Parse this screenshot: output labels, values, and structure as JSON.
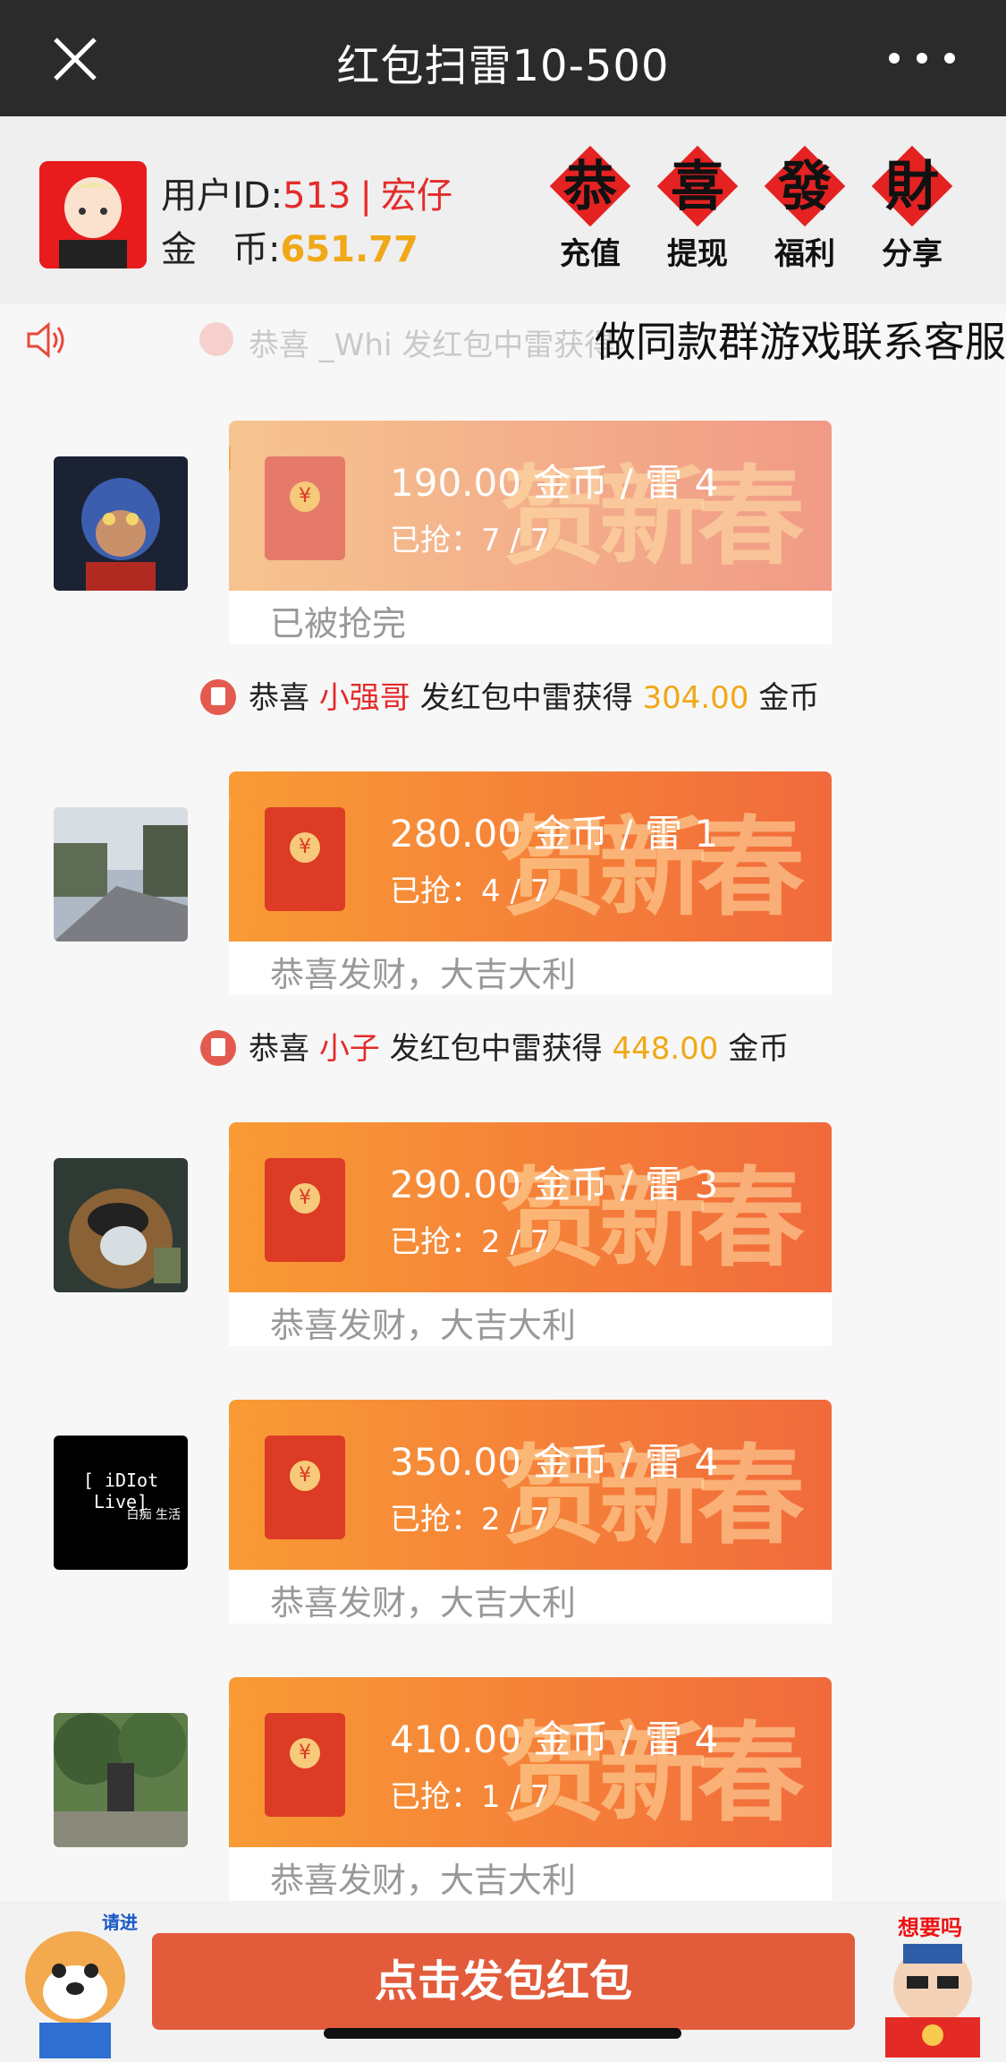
{
  "topbar": {
    "title": "红包扫雷10-500"
  },
  "user": {
    "id_label": "用户ID:",
    "id_value": "513",
    "separator": "|",
    "nickname": "宏仔",
    "coins_label": "金　币:",
    "coins_value": "651.77"
  },
  "actions": [
    {
      "glyph": "恭",
      "label": "充值"
    },
    {
      "glyph": "喜",
      "label": "提现"
    },
    {
      "glyph": "發",
      "label": "福利"
    },
    {
      "glyph": "財",
      "label": "分享"
    }
  ],
  "notice": {
    "scrolling_text": "恭喜 _Whi 发红包中雷获得",
    "ad_text": "做同款群游戏联系客服"
  },
  "packets": [
    {
      "amount": "190.00 金币 / 雷 4",
      "grabbed": "已抢：7 / 7",
      "footer": "已被抢完",
      "state": "done"
    },
    {
      "amount": "280.00 金币 / 雷 1",
      "grabbed": "已抢：4 / 7",
      "footer": "恭喜发财，大吉大利",
      "state": "live"
    },
    {
      "amount": "290.00 金币 / 雷 3",
      "grabbed": "已抢：2 / 7",
      "footer": "恭喜发财，大吉大利",
      "state": "live"
    },
    {
      "amount": "350.00 金币 / 雷 4",
      "grabbed": "已抢：2 / 7",
      "footer": "恭喜发财，大吉大利",
      "state": "live"
    },
    {
      "amount": "410.00 金币 / 雷 4",
      "grabbed": "已抢：1 / 7",
      "footer": "恭喜发财，大吉大利",
      "state": "live"
    }
  ],
  "wins": [
    {
      "prefix": "恭喜 ",
      "name": "小强哥",
      "middle": " 发红包中雷获得 ",
      "coins": "304.00",
      "suffix": " 金币"
    },
    {
      "prefix": "恭喜 ",
      "name": "小子",
      "middle": " 发红包中雷获得 ",
      "coins": "448.00",
      "suffix": " 金币"
    }
  ],
  "avatars": {
    "idiot_live_title": "[ iDIot Live]",
    "idiot_live_sub": "白痴 生活"
  },
  "bottombar": {
    "send_label": "点击发包红包",
    "left_tag": "请进",
    "right_tag": "想要吗"
  }
}
